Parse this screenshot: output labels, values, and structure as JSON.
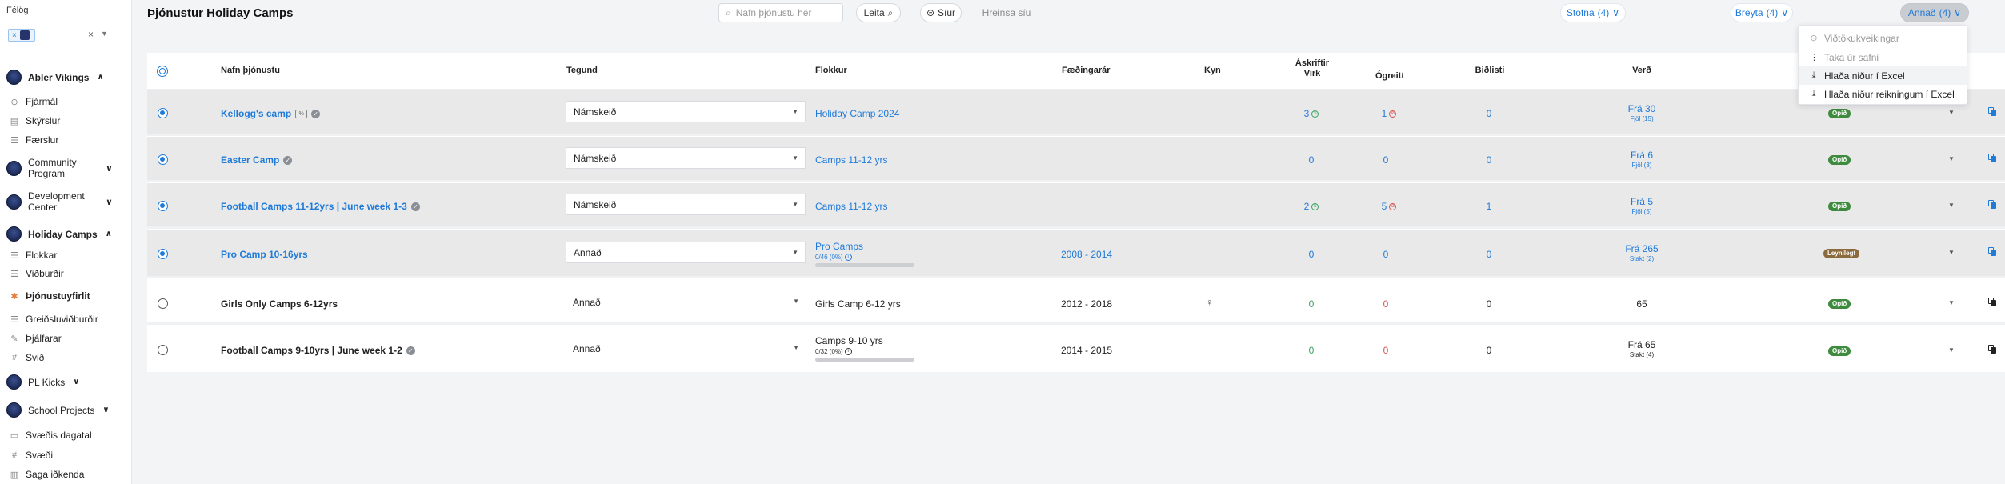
{
  "sidebar": {
    "club_label": "Félög",
    "chip_label": "×",
    "clear": "×",
    "groups": [
      {
        "label": "Abler Vikings",
        "items": [
          "Fjármál",
          "Skýrslur",
          "Færslur"
        ]
      },
      {
        "label": "Community Program"
      },
      {
        "label": "Development Center"
      },
      {
        "label": "Holiday Camps",
        "items": [
          "Flokkar",
          "Viðburðir",
          "Þjónustuyfirlit",
          "Greiðsluviðburðir",
          "Þjálfarar",
          "Svið"
        ]
      },
      {
        "label": "PL Kicks"
      },
      {
        "label": "School Projects"
      }
    ],
    "footer_items": [
      "Svæðis dagatal",
      "Svæði",
      "Saga iðkenda"
    ]
  },
  "header": {
    "title": "Þjónustur Holiday Camps",
    "search_placeholder": "Nafn þjónustu hér",
    "search_button": "Leita",
    "filter_button": "Síur",
    "clear_button": "Hreinsa síu",
    "create_button": "Stofna",
    "create_count": "(4)",
    "edit_button": "Breyta",
    "edit_count": "(4)",
    "other_button": "Annað",
    "other_count": "(4)"
  },
  "menu": {
    "items": [
      "Viðtökukveikingar",
      "Taka úr safni",
      "Hlaða niður í Excel",
      "Hlaða niður reikningum í Excel"
    ]
  },
  "table": {
    "columns": {
      "name": "Nafn þjónustu",
      "type": "Tegund",
      "category": "Flokkur",
      "birth_years": "Fæðingarár",
      "gender": "Kyn",
      "subs_line1": "Áskriftir",
      "subs_line2": "Virk",
      "unpaid": "Ógreitt",
      "waitlist": "Biðlisti",
      "price": "Verð"
    },
    "rows": [
      {
        "name": "Kellogg's camp",
        "type": "Námskeið",
        "category": "Holiday Camp 2024",
        "years": "",
        "active": "3",
        "unpaid": "1",
        "waitlist": "0",
        "price": "Frá 30",
        "price_sub": "Fjöl (15)",
        "status": "Opið"
      },
      {
        "name": "Easter Camp",
        "type": "Námskeið",
        "category": "Camps 11-12 yrs",
        "years": "",
        "active": "0",
        "unpaid": "0",
        "waitlist": "0",
        "price": "Frá 6",
        "price_sub": "Fjöl (3)",
        "status": "Opið"
      },
      {
        "name": "Football Camps 11-12yrs | June week 1-3",
        "type": "Námskeið",
        "category": "Camps 11-12 yrs",
        "years": "",
        "active": "2",
        "unpaid": "5",
        "waitlist": "1",
        "price": "Frá 5",
        "price_sub": "Fjöl (5)",
        "status": "Opið"
      },
      {
        "name": "Pro Camp 10-16yrs",
        "type": "Annað",
        "category": "Pro Camps",
        "category_sub": "0/46 (0%)",
        "years": "2008 - 2014",
        "active": "0",
        "unpaid": "0",
        "waitlist": "0",
        "price": "Frá 265",
        "price_sub": "Stakt (2)",
        "status": "Leynilegt"
      },
      {
        "name": "Girls Only Camps 6-12yrs",
        "type": "Annað",
        "category": "Girls Camp 6-12 yrs",
        "years": "2012 - 2018",
        "active": "0",
        "unpaid": "0",
        "waitlist": "0",
        "price": "65",
        "status": "Opið"
      },
      {
        "name": "Football Camps 9-10yrs | June week 1-2",
        "type": "Annað",
        "category": "Camps 9-10 yrs",
        "category_sub": "0/32 (0%)",
        "years": "2014 - 2015",
        "active": "0",
        "unpaid": "0",
        "waitlist": "0",
        "price": "Frá 65",
        "price_sub": "Stakt (4)",
        "status": "Opið"
      }
    ]
  },
  "colors": {
    "accent": "#1f7ad8",
    "sidebar_logo": "#1c2a57",
    "open_badge": "#3e8a3e",
    "secret_badge": "#8b6b3e"
  }
}
